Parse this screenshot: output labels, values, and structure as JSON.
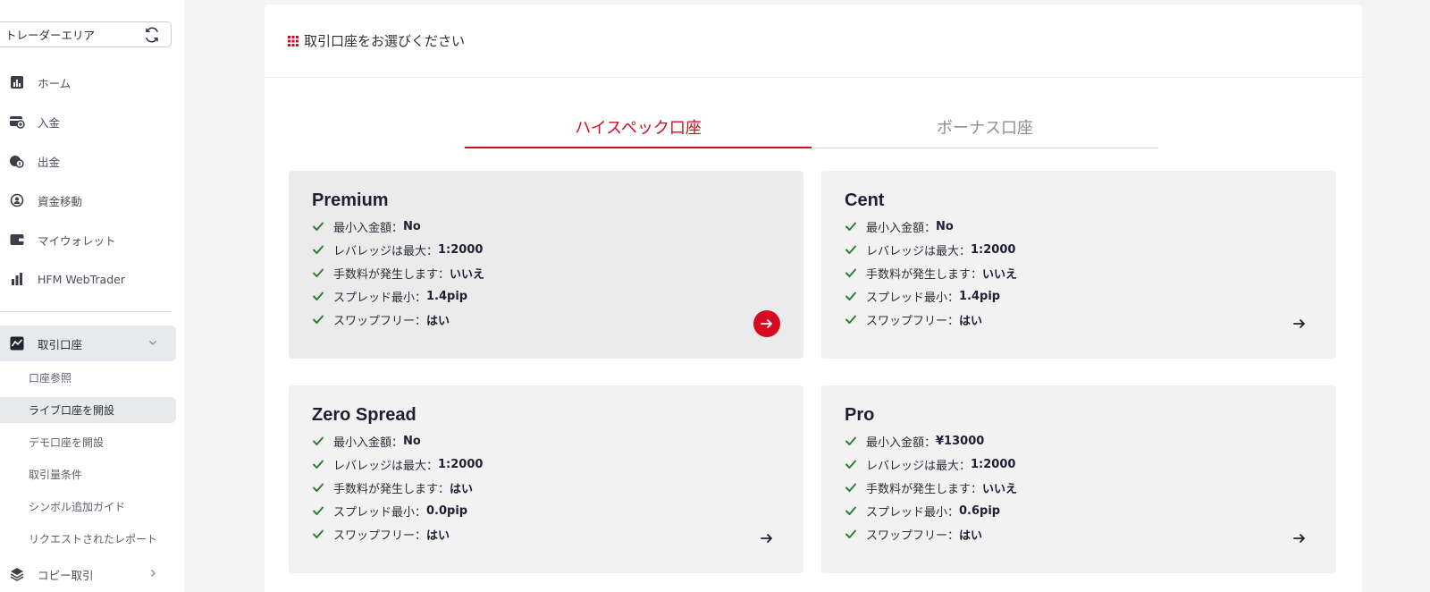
{
  "sidebar": {
    "area_select": {
      "label": "トレーダーエリア"
    },
    "nav": [
      {
        "label": "ホーム",
        "icon": "chart-icon"
      },
      {
        "label": "入金",
        "icon": "deposit-icon"
      },
      {
        "label": "出金",
        "icon": "withdraw-icon"
      },
      {
        "label": "資金移動",
        "icon": "transfer-icon"
      },
      {
        "label": "マイウォレット",
        "icon": "wallet-icon"
      },
      {
        "label": "HFM WebTrader",
        "icon": "bar-chart-icon"
      }
    ],
    "accounts_section": {
      "label": "取引口座",
      "icon": "trading-chart-icon"
    },
    "sub_items": [
      {
        "label": "口座参照"
      },
      {
        "label": "ライブ口座を開設"
      },
      {
        "label": "デモ口座を開設"
      },
      {
        "label": "取引量条件"
      },
      {
        "label": "シンボル追加ガイド"
      },
      {
        "label": "リクエストされたレポート"
      }
    ],
    "copy_trade": {
      "label": "コピー取引",
      "icon": "layers-icon"
    }
  },
  "main": {
    "header": {
      "title": "取引口座をお選びください"
    },
    "tabs": [
      {
        "label": "ハイスペック口座",
        "active": true
      },
      {
        "label": "ボーナス口座",
        "active": false
      }
    ],
    "cards": [
      {
        "title": "Premium",
        "features": [
          {
            "label": "最小入金額：",
            "value": "No"
          },
          {
            "label": "レバレッジは最大： ",
            "value": "1:2000"
          },
          {
            "label": "手数料が発生します：",
            "value": "いいえ"
          },
          {
            "label": "スプレッド最小：",
            "value": "1.4pip"
          },
          {
            "label": "スワップフリー：",
            "value": "はい"
          }
        ]
      },
      {
        "title": "Cent",
        "features": [
          {
            "label": "最小入金額：",
            "value": "No"
          },
          {
            "label": "レバレッジは最大： ",
            "value": "1:2000"
          },
          {
            "label": "手数料が発生します：",
            "value": "いいえ"
          },
          {
            "label": "スプレッド最小：",
            "value": "1.4pip"
          },
          {
            "label": "スワップフリー：",
            "value": "はい"
          }
        ]
      },
      {
        "title": "Zero Spread",
        "features": [
          {
            "label": "最小入金額：",
            "value": "No"
          },
          {
            "label": "レバレッジは最大： ",
            "value": "1:2000"
          },
          {
            "label": "手数料が発生します：",
            "value": "はい"
          },
          {
            "label": "スプレッド最小：",
            "value": "0.0pip"
          },
          {
            "label": "スワップフリー：",
            "value": "はい"
          }
        ]
      },
      {
        "title": "Pro",
        "features": [
          {
            "label": "最小入金額：",
            "value": "¥13000"
          },
          {
            "label": "レバレッジは最大： ",
            "value": "1:2000"
          },
          {
            "label": "手数料が発生します：",
            "value": "いいえ"
          },
          {
            "label": "スプレッド最小：",
            "value": "0.6pip"
          },
          {
            "label": "スワップフリー：",
            "value": "はい"
          }
        ]
      }
    ]
  },
  "colors": {
    "accent": "#d50c1f",
    "check": "#2e7d32",
    "card_bg": "#f2f2f3"
  }
}
